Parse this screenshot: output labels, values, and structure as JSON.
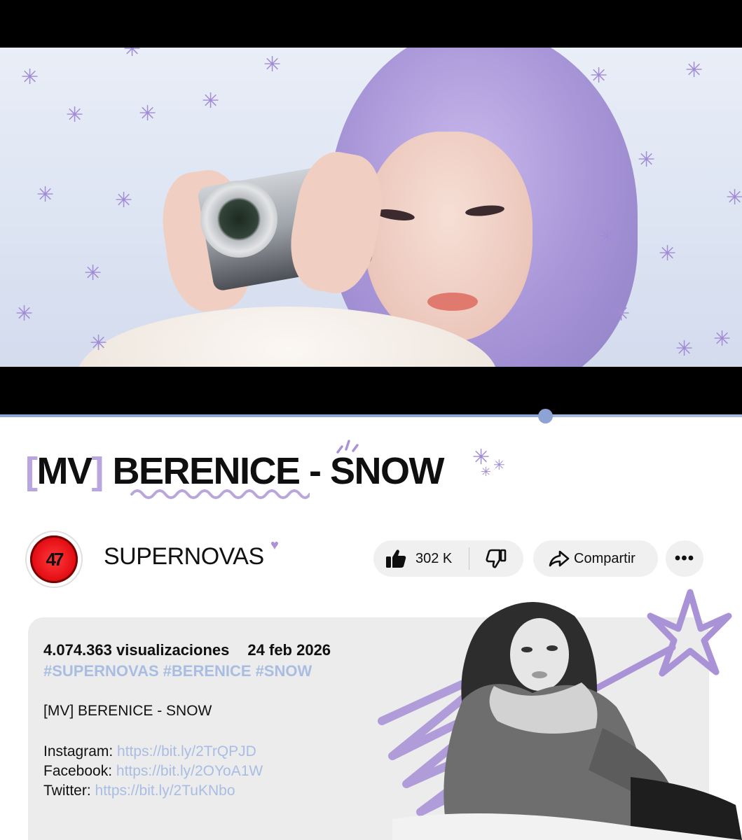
{
  "video": {
    "progress_fraction": 0.735
  },
  "title": {
    "bracket_open": "[",
    "mv": "MV",
    "bracket_close": "]",
    "rest": "BERENICE - SNOW"
  },
  "channel": {
    "name": "SUPERNOVAS",
    "avatar_mark": "47"
  },
  "actions": {
    "like_count": "302 K",
    "share_label": "Compartir",
    "more_label": "•••"
  },
  "description": {
    "views": "4.074.363 visualizaciones",
    "date": "24 feb 2026",
    "hashtags": [
      "#SUPERNOVAS",
      "#BERENICE",
      "#SNOW"
    ],
    "body_title": "[MV] BERENICE - SNOW",
    "links": [
      {
        "label": "Instagram: ",
        "url": "https://bit.ly/2TrQPJD"
      },
      {
        "label": "Facebook: ",
        "url": "https://bit.ly/2OYoA1W"
      },
      {
        "label": "Twitter: ",
        "url": "https://bit.ly/2TuKNbo"
      }
    ]
  },
  "colors": {
    "accent_lavender": "#a993d6",
    "link_blue": "#a9bde3",
    "progress": "#8da3d4"
  },
  "icons": [
    "thumbs-up-icon",
    "thumbs-down-icon",
    "share-arrow-icon",
    "more-icon",
    "heart-icon",
    "snowflake-icon",
    "star-doodle-icon"
  ]
}
